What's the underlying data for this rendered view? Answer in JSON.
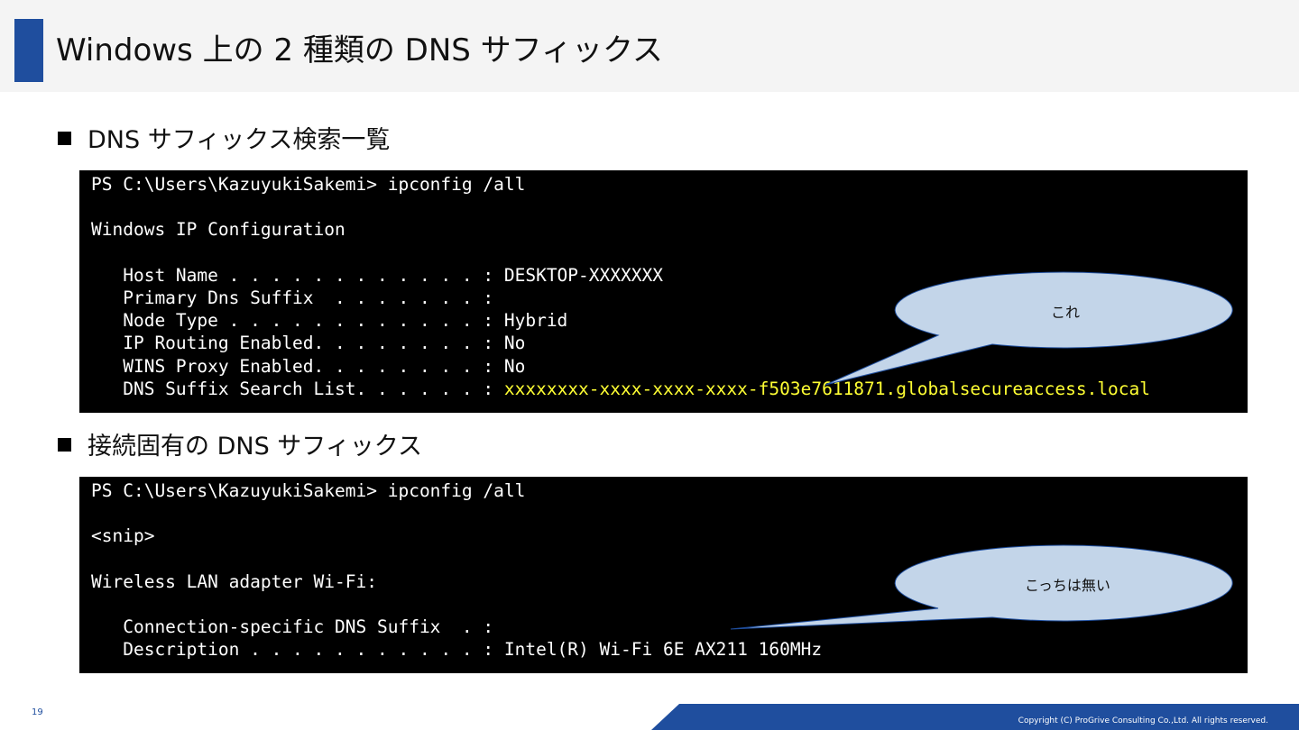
{
  "slide": {
    "title": "Windows 上の 2 種類の DNS サフィックス",
    "page_number": "19",
    "copyright": "Copyright (C) ProGrive Consulting Co.,Ltd. All rights reserved.",
    "accent_color": "#1f4e9e"
  },
  "section1": {
    "heading": "DNS サフィックス検索一覧",
    "terminal": {
      "lines": [
        "PS C:\\Users\\KazuyukiSakemi> ipconfig /all",
        "",
        "Windows IP Configuration",
        "",
        "   Host Name . . . . . . . . . . . . : DESKTOP-XXXXXXX",
        "   Primary Dns Suffix  . . . . . . . :",
        "   Node Type . . . . . . . . . . . . : Hybrid",
        "   IP Routing Enabled. . . . . . . . : No",
        "   WINS Proxy Enabled. . . . . . . . : No",
        "   DNS Suffix Search List. . . . . . : "
      ],
      "highlight": "xxxxxxxx-xxxx-xxxx-xxxx-f503e7611871.globalsecureaccess.local",
      "highlight_color": "#ffff33"
    },
    "callout": "これ"
  },
  "section2": {
    "heading": "接続固有の DNS サフィックス",
    "terminal": {
      "lines": [
        "PS C:\\Users\\KazuyukiSakemi> ipconfig /all",
        "",
        "<snip>",
        "",
        "Wireless LAN adapter Wi-Fi:",
        "",
        "   Connection-specific DNS Suffix  . :",
        "   Description . . . . . . . . . . . : Intel(R) Wi-Fi 6E AX211 160MHz"
      ]
    },
    "callout": "こっちは無い"
  },
  "colors": {
    "callout_fill": "#c3d5e9",
    "callout_stroke": "#1f4e9e",
    "terminal_bg": "#000000"
  }
}
